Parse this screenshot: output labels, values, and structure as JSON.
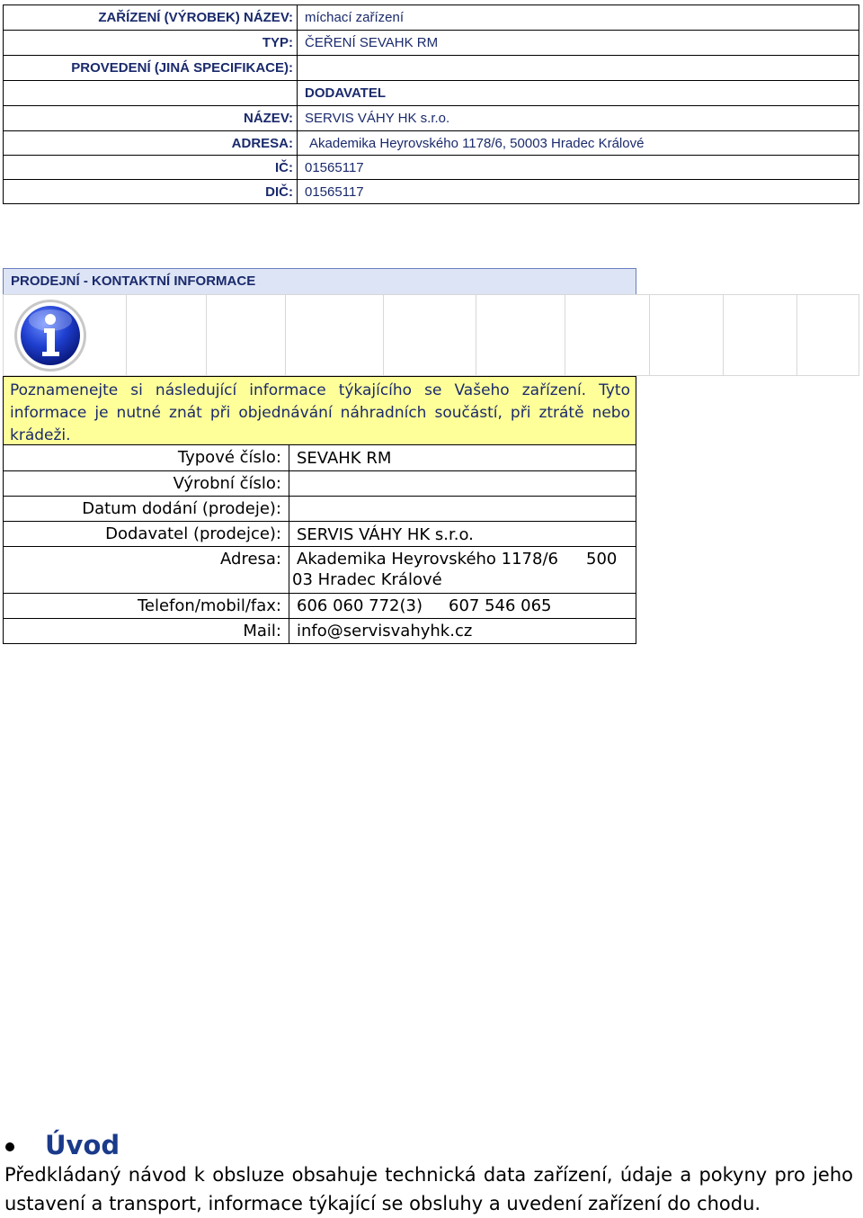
{
  "product": {
    "rows": [
      {
        "label": "ZAŘÍZENÍ (VÝROBEK) NÁZEV:",
        "value": "míchací zařízení"
      },
      {
        "label": "TYP:",
        "value": "ČEŘENÍ SEVAHK RM"
      },
      {
        "label": "PROVEDENÍ (JINÁ SPECIFIKACE):",
        "value": ""
      },
      {
        "label": "",
        "value": "DODAVATEL"
      },
      {
        "label": "NÁZEV:",
        "value": "SERVIS VÁHY HK s.r.o."
      },
      {
        "label": "ADRESA:",
        "value": "Akademika Heyrovského 1178/6, 50003 Hradec Králové"
      },
      {
        "label": "IČ:",
        "value": "01565117"
      },
      {
        "label": "DIČ:",
        "value": "01565117"
      }
    ]
  },
  "contact": {
    "heading": "PRODEJNÍ - KONTAKTNÍ INFORMACE",
    "icon": "info-icon",
    "note": "Poznamenejte si následující informace týkajícího se Vašeho zařízení. Tyto informace je nutné znát při objednávání náhradních součástí, při ztrátě nebo krádeži.",
    "rows": [
      {
        "label": "Typové číslo:",
        "value": "SEVAHK RM"
      },
      {
        "label": "Výrobní číslo:",
        "value": ""
      },
      {
        "label": "Datum dodání (prodeje):",
        "value": ""
      },
      {
        "label": "Dodavatel (prodejce):",
        "value": "SERVIS VÁHY HK s.r.o."
      },
      {
        "label": "Adresa:",
        "value": "Akademika Heyrovského 1178/6",
        "value_b": "500",
        "value_c": "03 Hradec Králové"
      },
      {
        "label": "Telefon/mobil/fax:",
        "value": "606 060 772(3)",
        "value_b": "607 546 065"
      },
      {
        "label": "Mail:",
        "value": "info@servisvahyhk.cz"
      }
    ]
  },
  "intro": {
    "heading": "Úvod",
    "text": "Předkládaný návod k obsluze obsahuje technická data zařízení, údaje a pokyny pro jeho ustavení a transport, informace týkající se obsluhy a uvedení zařízení do chodu."
  },
  "colors": {
    "navy_text": "#1a2a6c",
    "heading_bg": "#dde4f5",
    "note_bg": "#ffff99",
    "intro_heading": "#1a3a8a"
  }
}
